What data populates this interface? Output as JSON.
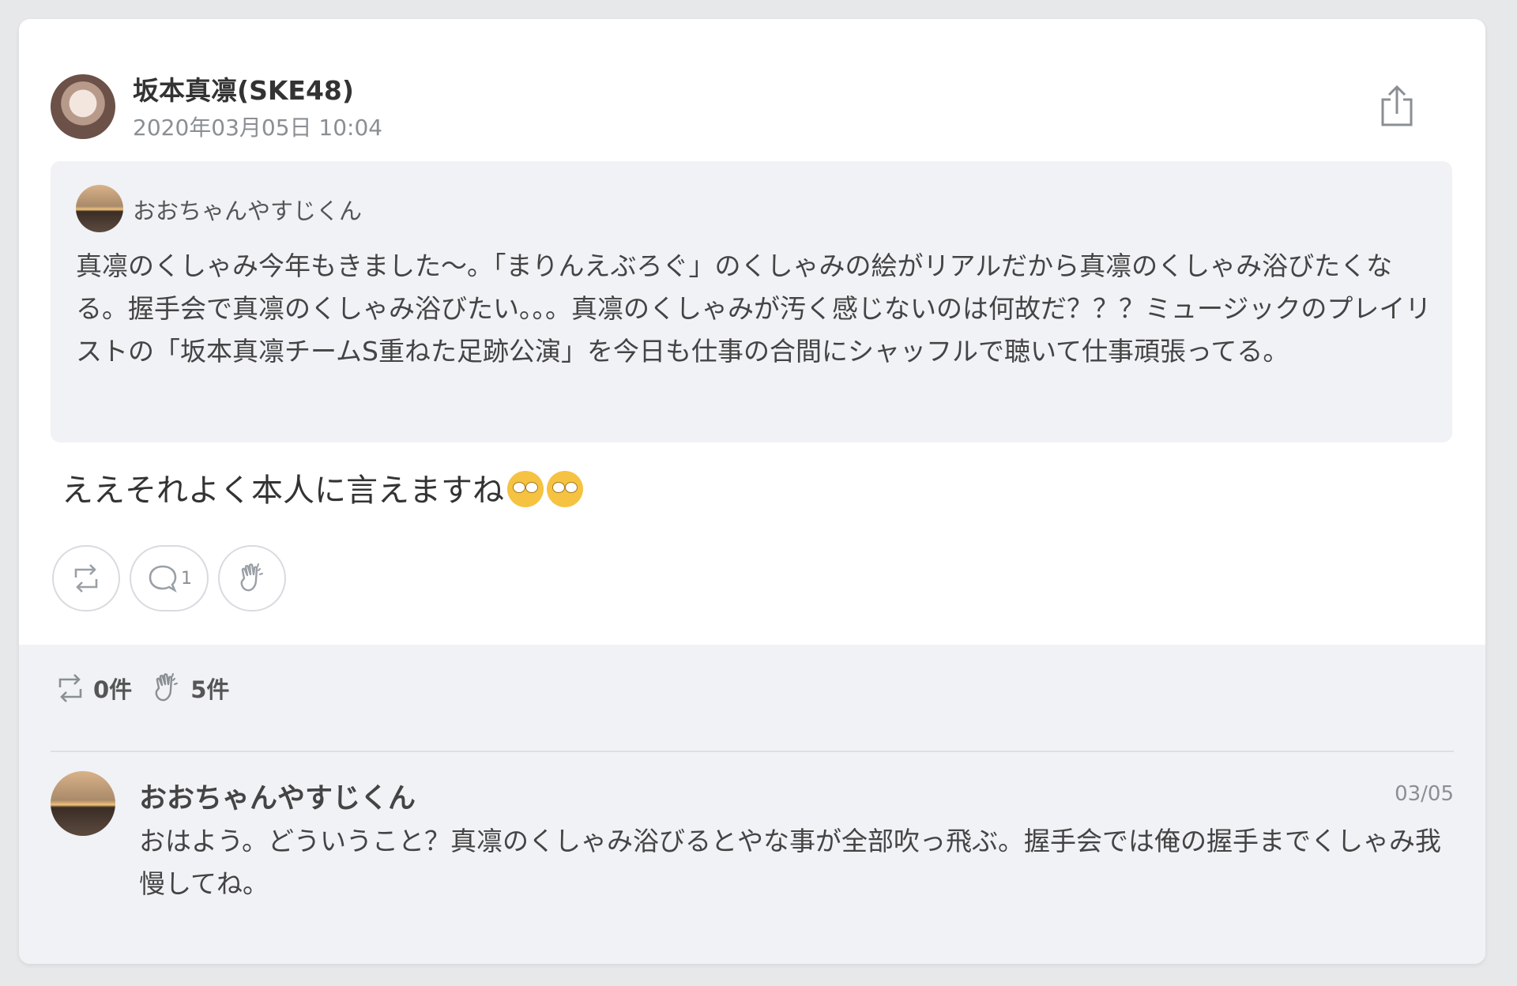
{
  "post": {
    "author_name": "坂本真凛(SKE48)",
    "timestamp": "2020年03月05日 10:04",
    "share_icon": "share-icon",
    "quote": {
      "author_name": "おおちゃんやすじくん",
      "text": "真凛のくしゃみ今年もきました〜。「まりんえぶろぐ」のくしゃみの絵がリアルだから真凛のくしゃみ浴びたくなる。握手会で真凛のくしゃみ浴びたい。。。真凛のくしゃみが汚く感じないのは何故だ？？？ミュージックのプレイリストの「坂本真凛チームS重ねた足跡公演」を今日も仕事の合間にシャッフルで聴いて仕事頑張ってる。"
    },
    "reply_text": "ええそれよく本人に言えますね",
    "reply_emojis": [
      "face-with-rolling-eyes",
      "face-with-rolling-eyes"
    ],
    "actions": {
      "retweet_icon": "retweet-icon",
      "comment_icon": "comment-icon",
      "comment_count": "1",
      "clap_icon": "clap-icon"
    }
  },
  "stats": {
    "retweets_label": "0件",
    "claps_label": "5件"
  },
  "comments": [
    {
      "author_name": "おおちゃんやすじくん",
      "date": "03/05",
      "text": "おはよう。どういうこと？真凛のくしゃみ浴びるとやな事が全部吹っ飛ぶ。握手会では俺の握手までくしゃみ我慢してね。"
    }
  ],
  "colors": {
    "card_bg": "#ffffff",
    "page_bg": "#e6e8ea",
    "quote_bg": "#f0f2f5",
    "muted_text": "#8a8f94"
  }
}
